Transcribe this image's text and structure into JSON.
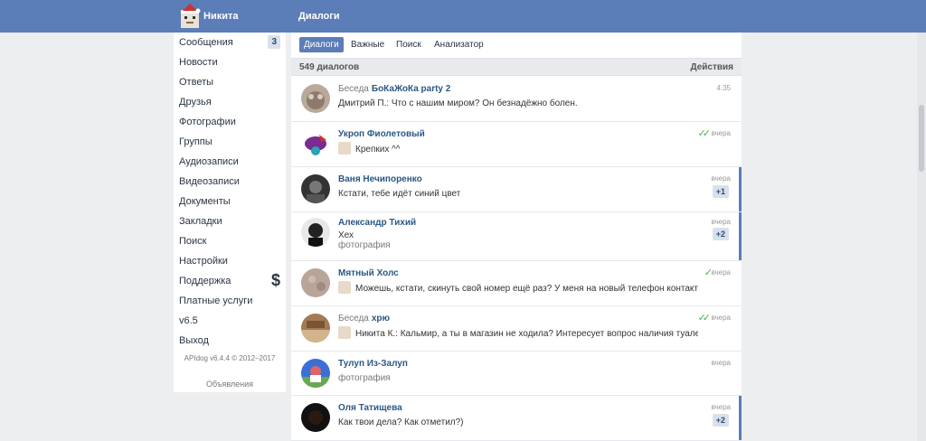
{
  "header": {
    "username": "Никита",
    "section": "Диалоги"
  },
  "sidebar": {
    "items": [
      {
        "label": "Сообщения",
        "count": "3"
      },
      {
        "label": "Новости"
      },
      {
        "label": "Ответы"
      },
      {
        "label": "Друзья"
      },
      {
        "label": "Фотографии"
      },
      {
        "label": "Группы"
      },
      {
        "label": "Аудиозаписи"
      },
      {
        "label": "Видеозаписи"
      },
      {
        "label": "Документы"
      },
      {
        "label": "Закладки"
      },
      {
        "label": "Поиск"
      },
      {
        "label": "Настройки"
      },
      {
        "label": "Поддержка",
        "icon": "$"
      },
      {
        "label": "Платные услуги"
      },
      {
        "label": "v6.5"
      },
      {
        "label": "Выход"
      }
    ],
    "copyright": "APIdog v6.4.4 © 2012–2017",
    "ads": "Объявления"
  },
  "tabs": [
    "Диалоги",
    "Важные",
    "Поиск",
    "Анализатор"
  ],
  "list": {
    "total": "549 диалогов",
    "actions": "Действия"
  },
  "dialogs": [
    {
      "prefix": "Беседа",
      "title": "БоКаЖоКа party 2",
      "message": "Дмитрий П.: Что с нашим миром? Он безнадёжно болен.",
      "time": "4:35"
    },
    {
      "title": "Укроп Фиолетовый",
      "message": "Крепких ^^",
      "time": "вчера",
      "read_checks": "✓✓"
    },
    {
      "title": "Ваня Нечипоренко",
      "message": "Кстати, тебе идёт синий цвет",
      "time": "вчера",
      "unread": "+1"
    },
    {
      "title": "Александр Тихий",
      "message": "Хех",
      "attachment": "фотография",
      "time": "вчера",
      "unread": "+2"
    },
    {
      "title": "Мятный Холс",
      "message": "Можешь, кстати, скинуть свой номер ещё раз? У меня на новый телефон контакты не пере",
      "time": "вчера",
      "read_checks": "✓"
    },
    {
      "prefix": "Беседа",
      "title": "хрю",
      "message": "Никита К.: Кальмир, а ты в магазин не ходила? Интересует вопрос наличия туалетной бу",
      "time": "вчера",
      "read_checks": "✓✓"
    },
    {
      "title": "Тулуп Из-Залуп",
      "attachment": "фотография",
      "time": "вчера"
    },
    {
      "title": "Оля Татищева",
      "message": "Как твои дела? Как отметил?)",
      "time": "вчера",
      "unread": "+2"
    }
  ],
  "colors": {
    "accent": "#5b7db8",
    "link": "#2a5885",
    "check": "#4caf50"
  }
}
